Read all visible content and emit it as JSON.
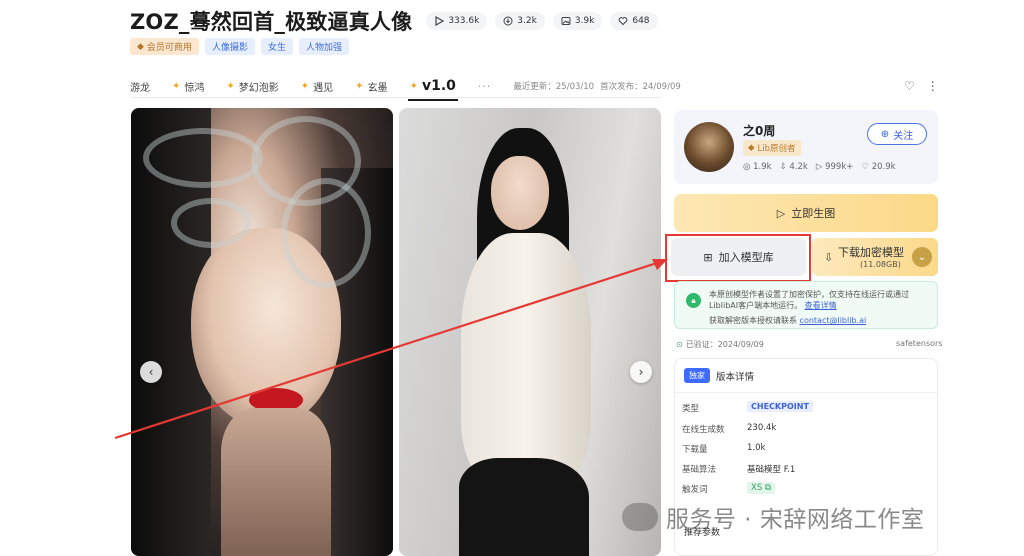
{
  "header": {
    "title": "ZOZ_蓦然回首_极致逼真人像",
    "stats": [
      {
        "icon": "play-icon",
        "value": "333.6k"
      },
      {
        "icon": "download-icon",
        "value": "3.2k"
      },
      {
        "icon": "image-icon",
        "value": "3.9k"
      },
      {
        "icon": "heart-icon",
        "value": "648"
      }
    ],
    "tags": [
      "会员可商用",
      "人像摄影",
      "女生",
      "人物加强"
    ]
  },
  "tabs": {
    "items": [
      "游龙",
      "惊鸿",
      "梦幻泡影",
      "遇见",
      "玄墨"
    ],
    "active": "v1.0",
    "more": "···",
    "updated": "最近更新：25/03/10",
    "published": "首次发布：24/09/09"
  },
  "author": {
    "name": "之0周",
    "badge": "Lib原创者",
    "stats": [
      "1.9k",
      "4.2k",
      "999k+",
      "20.9k"
    ],
    "follow_label": "关注"
  },
  "actions": {
    "generate_label": "立即生图",
    "add_label": "加入模型库",
    "download_label": "下载加密模型",
    "download_size": "(11.08GB)"
  },
  "notice": {
    "line1": "本原创模型作者设置了加密保护，仅支持在线运行或通过LiblibAI客户端本地运行。",
    "line1_link": "查看详情",
    "line2": "获取解密版本授权请联系",
    "line2_link": "contact@liblib.ai"
  },
  "verified": "已验证：2024/09/09",
  "format": "safetensors",
  "details": {
    "badge": "独家",
    "title": "版本详情",
    "rows": [
      {
        "key": "类型",
        "value": "CHECKPOINT"
      },
      {
        "key": "在线生成数",
        "value": "230.4k"
      },
      {
        "key": "下载量",
        "value": "1.0k"
      },
      {
        "key": "基础算法",
        "value": "基础模型 F.1"
      },
      {
        "key": "触发词",
        "value": "XS"
      }
    ],
    "recommend_label": "推荐参数"
  },
  "watermark": "服务号 · 宋辞网络工作室",
  "colors": {
    "accent_blue": "#3d63d6",
    "highlight_red": "#e53935",
    "gold": "#fbd987",
    "success_green": "#2fb96a"
  }
}
